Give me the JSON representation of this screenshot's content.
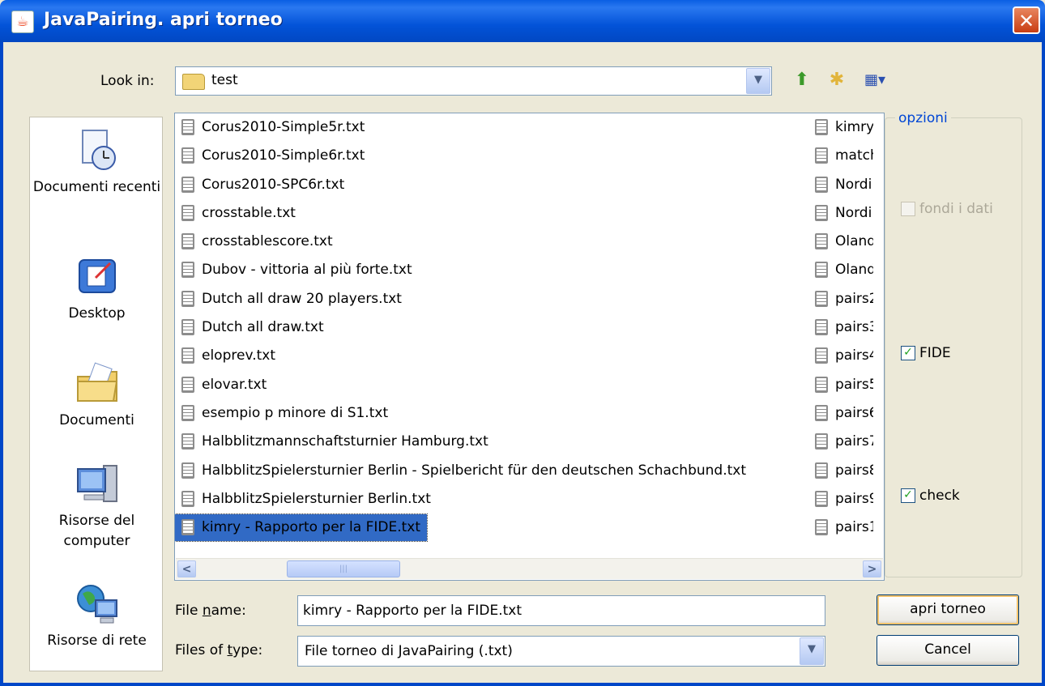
{
  "window": {
    "title": "JavaPairing. apri torneo",
    "close_glyph": "✕"
  },
  "lookin": {
    "label": "Look in:",
    "value": "test"
  },
  "toolbar": {
    "up_icon": "up-folder-icon",
    "new_folder_icon": "new-folder-icon",
    "view_icon": "view-menu-icon"
  },
  "places": [
    {
      "label": "Documenti recenti",
      "icon": "recent-documents-icon"
    },
    {
      "label": "Desktop",
      "icon": "desktop-icon"
    },
    {
      "label": "Documenti",
      "icon": "documents-icon"
    },
    {
      "label": "Risorse del computer",
      "icon": "my-computer-icon"
    },
    {
      "label": "Risorse di rete",
      "icon": "network-icon"
    }
  ],
  "files_col1": [
    "Corus2010-Simple5r.txt",
    "Corus2010-Simple6r.txt",
    "Corus2010-SPC6r.txt",
    "crosstable.txt",
    "crosstablescore.txt",
    "Dubov - vittoria al più forte.txt",
    "Dutch all draw 20 players.txt",
    "Dutch all draw.txt",
    "eloprev.txt",
    "elovar.txt",
    "esempio p minore di S1.txt",
    "Halbblitzmannschaftsturnier Hamburg.txt",
    "HalbblitzSpielersturnier Berlin - Spielbericht für den deutschen Schachbund.txt",
    "HalbblitzSpielersturnier Berlin.txt",
    "kimry - Rapporto per la FIDE.txt"
  ],
  "files_col2": [
    "kimry",
    "match",
    "Nordi",
    "Nordi",
    "Oland",
    "Oland",
    "pairs2",
    "pairs3",
    "pairs4",
    "pairs5",
    "pairs6",
    "pairs7",
    "pairs8",
    "pairs9",
    "pairs1"
  ],
  "selected_index": 14,
  "options": {
    "legend": "opzioni",
    "merge": {
      "label": "fondi i dati",
      "checked": false,
      "enabled": false
    },
    "fide": {
      "label": "FIDE",
      "checked": true
    },
    "check": {
      "label": "check",
      "checked": true
    }
  },
  "filename": {
    "label": "File name:",
    "value": "kimry - Rapporto per la FIDE.txt"
  },
  "filetype": {
    "label": "Files of type:",
    "value": "File torneo di JavaPairing (.txt)"
  },
  "buttons": {
    "open": "apri torneo",
    "cancel": "Cancel"
  }
}
